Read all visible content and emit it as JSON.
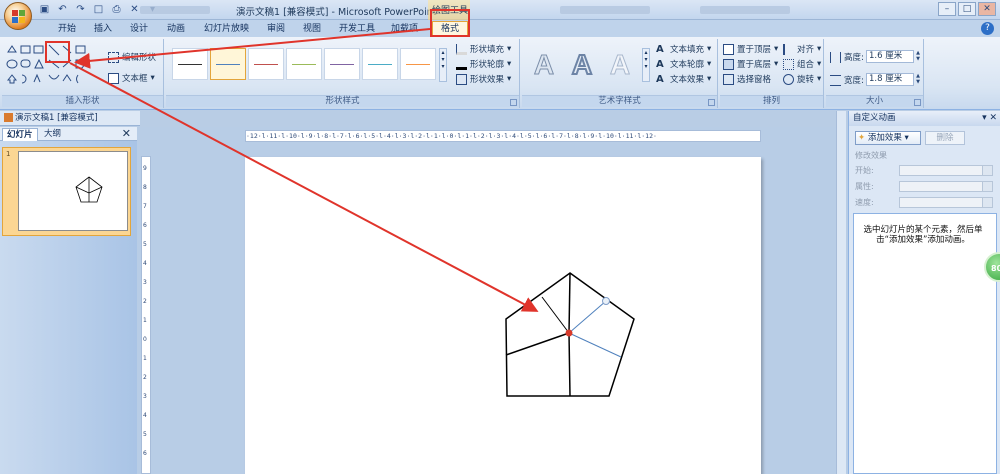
{
  "window": {
    "title": "演示文稿1 [兼容模式] - Microsoft PowerPoint",
    "context_tool": "绘图工具"
  },
  "tabs": [
    "开始",
    "插入",
    "设计",
    "动画",
    "幻灯片放映",
    "审阅",
    "视图",
    "开发工具",
    "加载项",
    "格式"
  ],
  "active_tab": "格式",
  "ribbon": {
    "insert_shapes": {
      "label": "插入形状",
      "edit_shape": "编辑形状",
      "textbox": "文本框"
    },
    "shape_styles": {
      "label": "形状样式",
      "fill": "形状填充",
      "outline": "形状轮廓",
      "effects": "形状效果",
      "line_colors": [
        "#4f81bd",
        "#c0504d",
        "#9bbb59",
        "#8064a2",
        "#4bacc6",
        "#f79646",
        "#333333"
      ]
    },
    "wordart": {
      "label": "艺术字样式",
      "text_fill": "文本填充",
      "text_outline": "文本轮廓",
      "text_effects": "文本效果",
      "glyph": "A"
    },
    "arrange": {
      "label": "排列",
      "bring_front": "置于顶层",
      "send_back": "置于底层",
      "selection_pane": "选择窗格",
      "align": "对齐",
      "group": "组合",
      "rotate": "旋转"
    },
    "size": {
      "label": "大小",
      "height_label": "高度:",
      "height_value": "1.6 厘米",
      "width_label": "宽度:",
      "width_value": "1.8 厘米"
    }
  },
  "document_tab": "演示文稿1 [兼容模式]",
  "left_pane": {
    "tab_slides": "幻灯片",
    "tab_outline": "大纲",
    "slide_number": "1"
  },
  "ruler": {
    "text": "·12·l·11·l·10·l·9·l·8·l·7·l·6·l·5·l·4·l·3·l·2·l·1·l·0·l·1·l·2·l·3·l·4·l·5·l·6·l·7·l·8·l·9·l·10·l·11·l·12·",
    "vertical": [
      "9",
      "8",
      "7",
      "6",
      "5",
      "4",
      "3",
      "2",
      "1",
      "0",
      "1",
      "2",
      "3",
      "4",
      "5",
      "6"
    ]
  },
  "task_pane": {
    "title": "自定义动画",
    "add_effect": "添加效果",
    "remove": "删除",
    "modify_effect": "修改效果",
    "start_label": "开始:",
    "property_label": "属性:",
    "speed_label": "速度:",
    "hint": "选中幻灯片的某个元素，然后单击“添加效果”添加动画。"
  },
  "badge": "80",
  "colors": {
    "annotation": "#e0342b",
    "accent": "#e3a53b"
  }
}
